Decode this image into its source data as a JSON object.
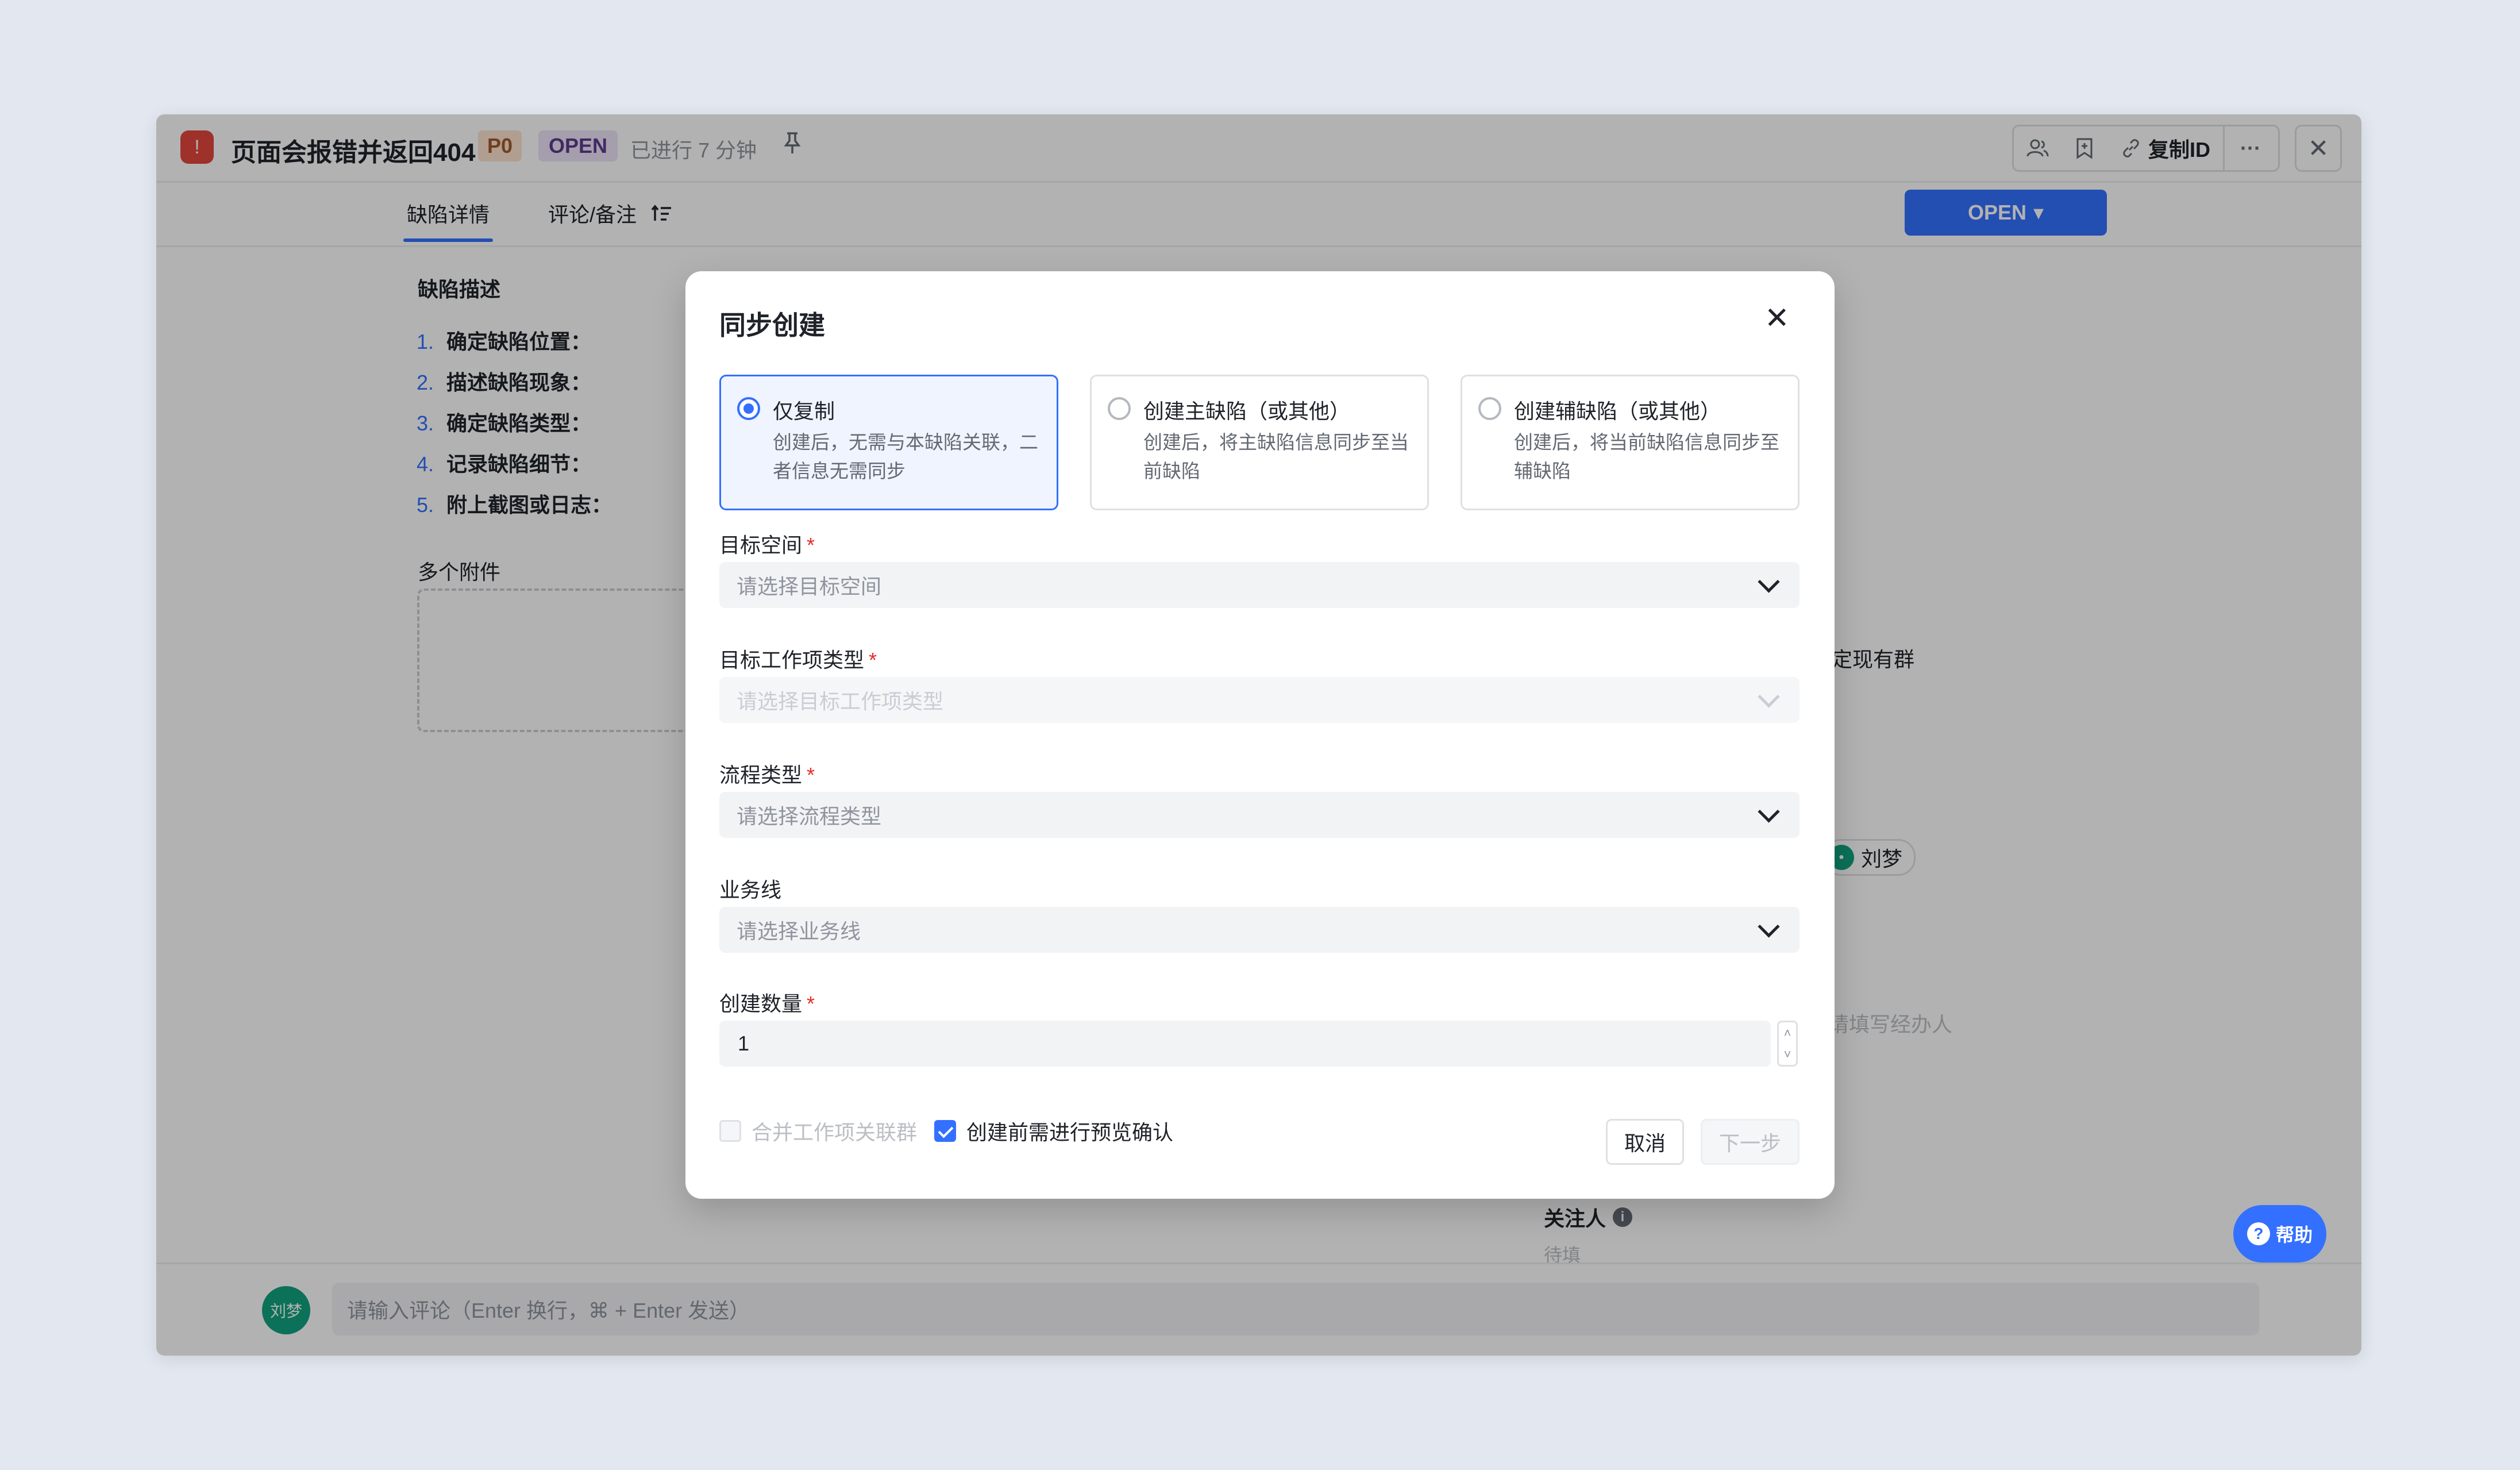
{
  "header": {
    "bug_icon": "alert-circle-icon",
    "title": "页面会报错并返回404",
    "priority": "P0",
    "status": "OPEN",
    "elapsed": "已进行 7 分钟",
    "pin_icon": "pin-icon",
    "copy_id_label": "复制ID",
    "more_label": "···",
    "close_label": "✕"
  },
  "tabs": [
    {
      "label": "缺陷详情",
      "active": true
    },
    {
      "label": "评论/备注",
      "active": false
    }
  ],
  "status_button": {
    "label": "OPEN",
    "arrow": "▾"
  },
  "content": {
    "description_title": "缺陷描述",
    "steps": [
      {
        "n": "1.",
        "text": "确定缺陷位置："
      },
      {
        "n": "2.",
        "text": "描述缺陷现象："
      },
      {
        "n": "3.",
        "text": "确定缺陷类型："
      },
      {
        "n": "4.",
        "text": "记录缺陷细节："
      },
      {
        "n": "5.",
        "text": "附上截图或日志："
      }
    ],
    "attachments_title": "多个附件",
    "bind_group_text": "绑定现有群",
    "assignee_name": "刘梦",
    "handler_placeholder": "请填写经办人",
    "follower_label": "关注人",
    "follower_placeholder": "待填"
  },
  "help_button": {
    "label": "帮助"
  },
  "comment": {
    "avatar_text": "刘梦",
    "placeholder": "请输入评论（Enter 换行，⌘ + Enter 发送）"
  },
  "modal": {
    "title": "同步创建",
    "close_label": "✕",
    "options": [
      {
        "label": "仅复制",
        "desc": "创建后，无需与本缺陷关联，二者信息无需同步",
        "selected": true
      },
      {
        "label": "创建主缺陷（或其他）",
        "desc": "创建后，将主缺陷信息同步至当前缺陷",
        "selected": false
      },
      {
        "label": "创建辅缺陷（或其他）",
        "desc": "创建后，将当前缺陷信息同步至辅缺陷",
        "selected": false
      }
    ],
    "fields": {
      "target_space": {
        "label": "目标空间",
        "required": "*",
        "placeholder": "请选择目标空间"
      },
      "target_type": {
        "label": "目标工作项类型",
        "required": "*",
        "placeholder": "请选择目标工作项类型"
      },
      "process_type": {
        "label": "流程类型",
        "required": "*",
        "placeholder": "请选择流程类型"
      },
      "business_line": {
        "label": "业务线",
        "placeholder": "请选择业务线"
      },
      "quantity": {
        "label": "创建数量",
        "required": "*",
        "value": "1"
      }
    },
    "merge_group_label": "合并工作项关联群",
    "merge_group_checked": false,
    "preview_confirm_label": "创建前需进行预览确认",
    "preview_confirm_checked": true,
    "cancel_label": "取消",
    "next_label": "下一步"
  },
  "colors": {
    "accent": "#3370ff",
    "danger": "#e2473b",
    "avatar": "#10a37f"
  }
}
